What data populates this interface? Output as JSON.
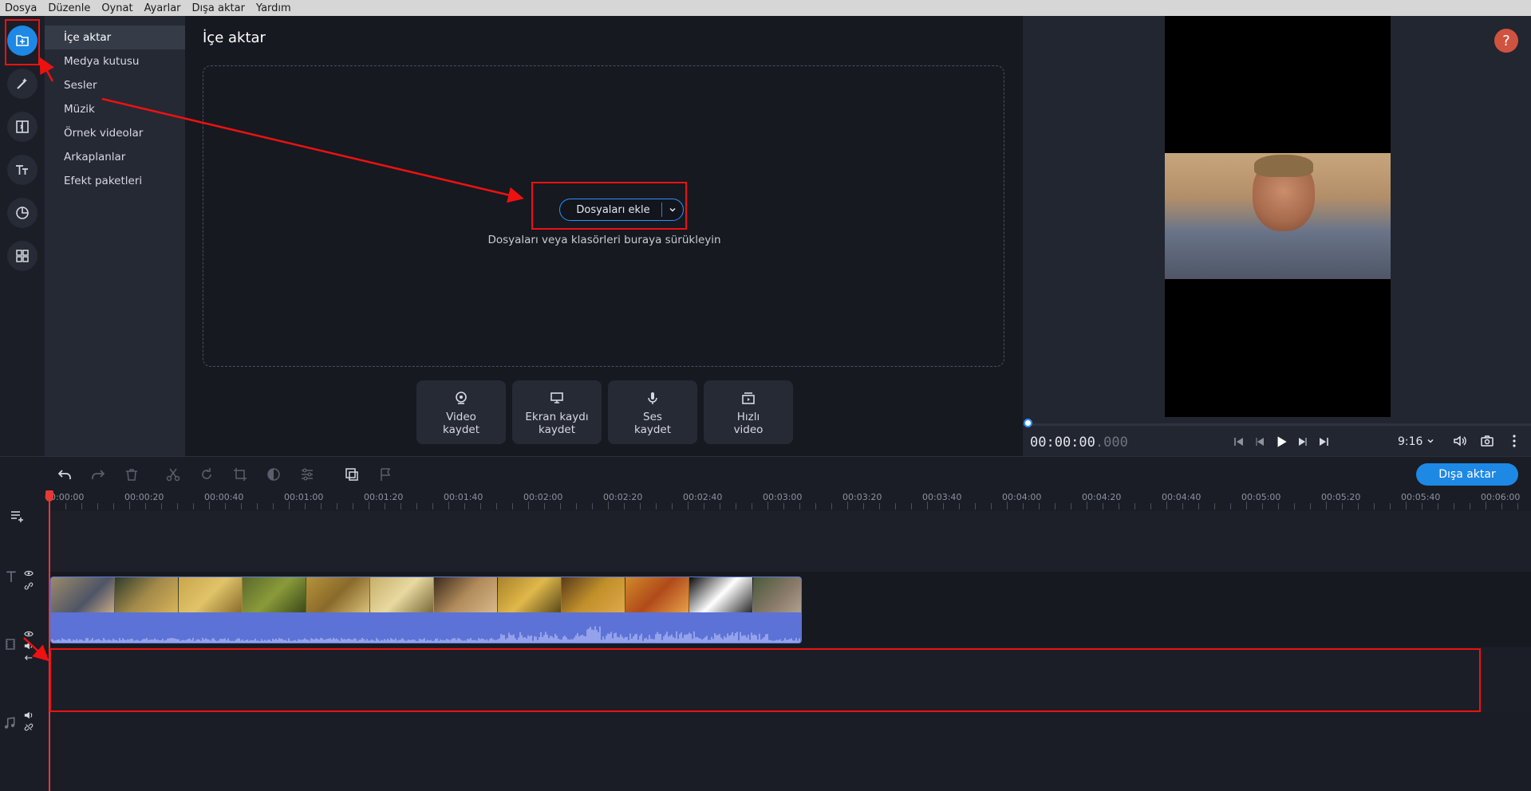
{
  "menu": {
    "items": [
      {
        "label": "Dosya"
      },
      {
        "label": "Düzenle"
      },
      {
        "label": "Oynat"
      },
      {
        "label": "Ayarlar"
      },
      {
        "label": "Dışa aktar"
      },
      {
        "label": "Yardım"
      }
    ]
  },
  "sidebar": {
    "tools": [
      {
        "icon": "import-icon",
        "active": true
      },
      {
        "icon": "magic-wand-icon",
        "active": false
      },
      {
        "icon": "transitions-icon",
        "active": false
      },
      {
        "icon": "titles-icon",
        "active": false
      },
      {
        "icon": "stickers-icon",
        "active": false
      },
      {
        "icon": "more-tools-icon",
        "active": false
      }
    ],
    "categories": [
      {
        "label": "İçe aktar",
        "active": true
      },
      {
        "label": "Medya kutusu",
        "active": false
      },
      {
        "label": "Sesler",
        "active": false
      },
      {
        "label": "Müzik",
        "active": false
      },
      {
        "label": "Örnek videolar",
        "active": false
      },
      {
        "label": "Arkaplanlar",
        "active": false
      },
      {
        "label": "Efekt paketleri",
        "active": false
      }
    ]
  },
  "import_panel": {
    "title": "İçe aktar",
    "add_files_label": "Dosyaları ekle",
    "drop_hint": "Dosyaları veya klasörleri buraya sürükleyin",
    "record_buttons": [
      {
        "icon": "webcam-icon",
        "line1": "Video",
        "line2": "kaydet"
      },
      {
        "icon": "screen-icon",
        "line1": "Ekran kaydı",
        "line2": "kaydet"
      },
      {
        "icon": "microphone-icon",
        "line1": "Ses",
        "line2": "kaydet"
      },
      {
        "icon": "quick-video-icon",
        "line1": "Hızlı",
        "line2": "video"
      }
    ]
  },
  "preview": {
    "help_label": "?",
    "timecode": "00:00:00",
    "timecode_ms": ".000",
    "aspect_ratio": "9:16",
    "playback_progress": 0
  },
  "timeline": {
    "export_label": "Dışa aktar",
    "ruler_labels": [
      "00:00:00",
      "00:00:20",
      "00:00:40",
      "00:01:00",
      "00:01:20",
      "00:01:40",
      "00:02:00",
      "00:02:20",
      "00:02:40",
      "00:03:00",
      "00:03:20",
      "00:03:40",
      "00:04:00",
      "00:04:20",
      "00:04:40",
      "00:05:00",
      "00:05:20",
      "00:05:40",
      "00:06:00"
    ]
  },
  "colors": {
    "accent": "#1e88e5",
    "annotation": "#e11111",
    "playhead": "#e53935",
    "clip": "#5a6ed1"
  }
}
